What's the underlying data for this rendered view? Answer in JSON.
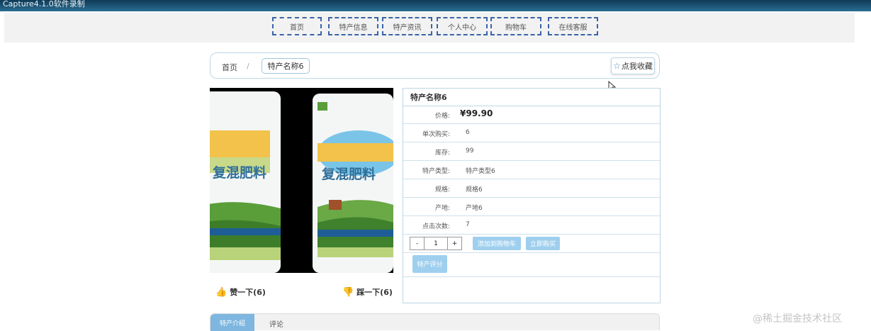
{
  "window": {
    "title": "Capture4.1.0软件录制"
  },
  "nav": [
    "首页",
    "特产信息",
    "特产资讯",
    "个人中心",
    "购物车",
    "在线客服"
  ],
  "breadcrumb": {
    "home": "首页",
    "separator": "/",
    "current": "特产名称6"
  },
  "favorite_label": "点我收藏",
  "product": {
    "title": "特产名称6",
    "price_label": "价格:",
    "price": "¥99.90",
    "rows": [
      {
        "label": "单次购买:",
        "value": "6"
      },
      {
        "label": "库存:",
        "value": "99"
      },
      {
        "label": "特产类型:",
        "value": "特产类型6"
      },
      {
        "label": "规格:",
        "value": "规格6"
      },
      {
        "label": "产地:",
        "value": "产地6"
      },
      {
        "label": "点击次数:",
        "value": "7"
      }
    ],
    "quantity": "1",
    "minus": "-",
    "plus": "+",
    "add_to_cart": "添加到购物车",
    "buy_now": "立即购买",
    "rate": "特产评分",
    "image_text": {
      "main": "复混肥料",
      "side": "复混肥料"
    }
  },
  "votes": {
    "like": "赞一下(6)",
    "dislike": "踩一下(6)"
  },
  "tabs": {
    "active": "特产介绍",
    "other": "评论"
  },
  "watermark": "@稀土掘金技术社区",
  "colors": {
    "accent": "#9fcfee",
    "tab_active": "#7eb6df",
    "nav_border": "#3a63a8",
    "vote_icon": "#e0503c"
  }
}
